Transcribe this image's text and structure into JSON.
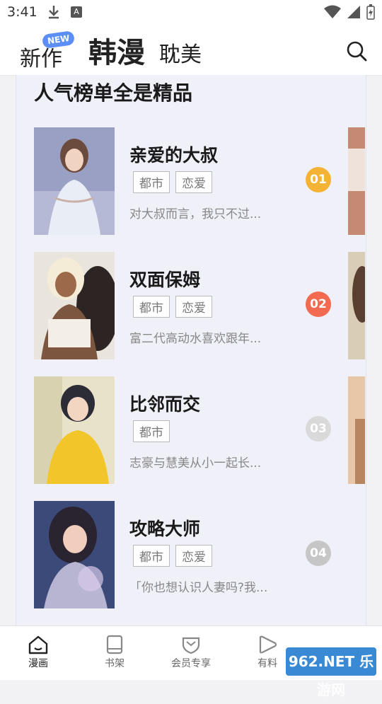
{
  "status_bar": {
    "time": "3:41"
  },
  "header": {
    "tabs": [
      {
        "label": "新作",
        "badge": "NEW"
      },
      {
        "label": "韩漫"
      },
      {
        "label": "耽美"
      }
    ]
  },
  "ranking": {
    "title": "人气榜单全是精品",
    "items": [
      {
        "title": "亲爱的大叔",
        "tags": [
          "都市",
          "恋爱"
        ],
        "desc": "对大叔而言，我只不过...",
        "rank": "01",
        "rank_color": "#f5b335"
      },
      {
        "title": "双面保姆",
        "tags": [
          "都市",
          "恋爱"
        ],
        "desc": "富二代高动水喜欢跟年...",
        "rank": "02",
        "rank_color": "#f26a4f"
      },
      {
        "title": "比邻而交",
        "tags": [
          "都市"
        ],
        "desc": "志豪与慧美从小一起长...",
        "rank": "03",
        "rank_color": "#d9d9d9"
      },
      {
        "title": "攻略大师",
        "tags": [
          "都市",
          "恋爱"
        ],
        "desc": "「你也想认识人妻吗?我...",
        "rank": "04",
        "rank_color": "#c6c6c6"
      }
    ]
  },
  "bottom_nav": [
    {
      "label": "漫画",
      "icon": "home-icon",
      "active": true
    },
    {
      "label": "书架",
      "icon": "book-icon"
    },
    {
      "label": "会员专享",
      "icon": "vip-icon"
    },
    {
      "label": "有料",
      "icon": "play-icon"
    }
  ],
  "watermark": {
    "text": "962.NET 乐游网"
  }
}
